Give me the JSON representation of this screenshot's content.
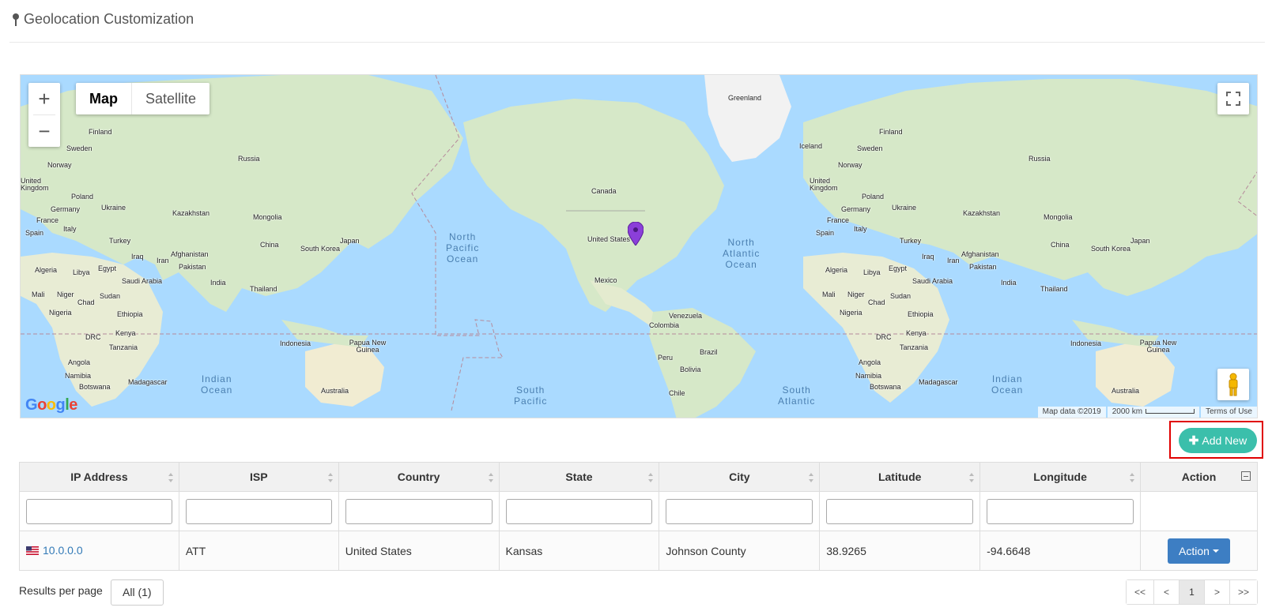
{
  "page": {
    "title": "Geolocation Customization"
  },
  "map": {
    "type_buttons": {
      "map": "Map",
      "satellite": "Satellite"
    },
    "zoom_in": "+",
    "zoom_out": "−",
    "logo": "Google",
    "attribution": {
      "map_data": "Map data ©2019",
      "scale": "2000 km",
      "terms": "Terms of Use"
    },
    "labels": [
      {
        "text": "Greenland"
      },
      {
        "text": "Iceland"
      },
      {
        "text": "Finland"
      },
      {
        "text": "Sweden"
      },
      {
        "text": "Norway"
      },
      {
        "text": "Russia"
      },
      {
        "text": "United Kingdom"
      },
      {
        "text": "Poland"
      },
      {
        "text": "Germany"
      },
      {
        "text": "Ukraine"
      },
      {
        "text": "France"
      },
      {
        "text": "Spain"
      },
      {
        "text": "Italy"
      },
      {
        "text": "Kazakhstan"
      },
      {
        "text": "Mongolia"
      },
      {
        "text": "Turkey"
      },
      {
        "text": "China"
      },
      {
        "text": "Japan"
      },
      {
        "text": "South Korea"
      },
      {
        "text": "Iraq"
      },
      {
        "text": "Iran"
      },
      {
        "text": "Afghanistan"
      },
      {
        "text": "Pakistan"
      },
      {
        "text": "India"
      },
      {
        "text": "Thailand"
      },
      {
        "text": "Algeria"
      },
      {
        "text": "Libya"
      },
      {
        "text": "Egypt"
      },
      {
        "text": "Saudi Arabia"
      },
      {
        "text": "Mali"
      },
      {
        "text": "Niger"
      },
      {
        "text": "Chad"
      },
      {
        "text": "Sudan"
      },
      {
        "text": "Nigeria"
      },
      {
        "text": "Ethiopia"
      },
      {
        "text": "Kenya"
      },
      {
        "text": "DRC"
      },
      {
        "text": "Tanzania"
      },
      {
        "text": "Angola"
      },
      {
        "text": "Namibia"
      },
      {
        "text": "Botswana"
      },
      {
        "text": "Madagascar"
      },
      {
        "text": "Indonesia"
      },
      {
        "text": "Papua New Guinea"
      },
      {
        "text": "Australia"
      },
      {
        "text": "Canada"
      },
      {
        "text": "United States"
      },
      {
        "text": "Mexico"
      },
      {
        "text": "Venezuela"
      },
      {
        "text": "Colombia"
      },
      {
        "text": "Brazil"
      },
      {
        "text": "Peru"
      },
      {
        "text": "Bolivia"
      },
      {
        "text": "Chile"
      }
    ],
    "oceans": [
      {
        "text": "North\nPacific\nOcean"
      },
      {
        "text": "North\nAtlantic\nOcean"
      },
      {
        "text": "Indian\nOcean"
      },
      {
        "text": "South\nPacific"
      },
      {
        "text": "South\nAtlantic"
      },
      {
        "text": "Indian\nOcean"
      }
    ]
  },
  "add_new": {
    "label": "Add New"
  },
  "table": {
    "columns": [
      "IP Address",
      "ISP",
      "Country",
      "State",
      "City",
      "Latitude",
      "Longitude",
      "Action"
    ],
    "rows": [
      {
        "ip": "10.0.0.0",
        "isp": "ATT",
        "country": "United States",
        "state": "Kansas",
        "city": "Johnson County",
        "latitude": "38.9265",
        "longitude": "-94.6648",
        "action": "Action"
      }
    ]
  },
  "footer": {
    "results_label": "Results per page",
    "results_value": "All (1)",
    "pager": [
      "<<",
      "<",
      "1",
      ">",
      ">>"
    ],
    "current_page": "1"
  }
}
